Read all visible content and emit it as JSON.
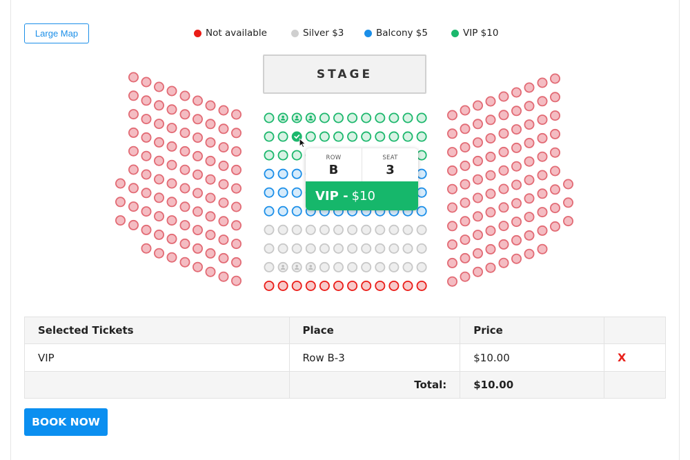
{
  "controls": {
    "large_map_label": "Large Map"
  },
  "legend": [
    {
      "label": "Not available",
      "color": "#ea1c17"
    },
    {
      "label": "Silver $3",
      "color": "#cfcfcf"
    },
    {
      "label": "Balcony $5",
      "color": "#1a8ee8"
    },
    {
      "label": "VIP $10",
      "color": "#1bb76c"
    }
  ],
  "stage": {
    "label": "STAGE"
  },
  "seat_colors": {
    "vip": {
      "stroke": "#1bb76c",
      "fill": "#d8f2e4"
    },
    "balcony": {
      "stroke": "#1a8ee8",
      "fill": "#d6ebfb"
    },
    "silver": {
      "stroke": "#c8c8c8",
      "fill": "#eeeeee"
    },
    "unavailable": {
      "stroke": "#ea1c17",
      "fill": "#f7c9c9"
    },
    "side": {
      "stroke": "#e26a74",
      "fill": "#f4bcc2"
    }
  },
  "tooltip": {
    "row_label": "ROW",
    "row_value": "B",
    "seat_label": "SEAT",
    "seat_value": "3",
    "category": "VIP -",
    "price": "$10"
  },
  "table": {
    "headers": [
      "Selected Tickets",
      "Place",
      "Price",
      ""
    ],
    "rows": [
      {
        "ticket": "VIP",
        "place": "Row B-3",
        "price": "$10.00",
        "remove": "X"
      }
    ],
    "total_label": "Total:",
    "total_value": "$10.00"
  },
  "book_button_label": "BOOK NOW"
}
